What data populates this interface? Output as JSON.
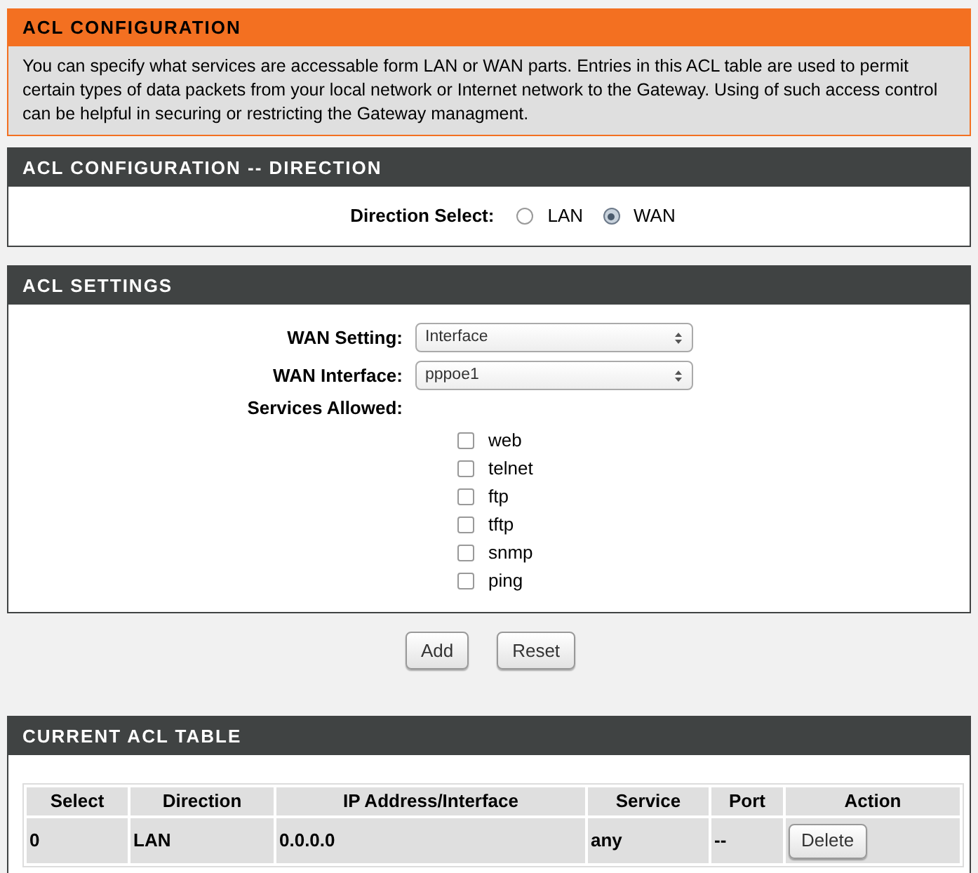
{
  "intro": {
    "title": "ACL CONFIGURATION",
    "text": "You can specify what services are accessable form LAN or WAN parts.   Entries in this ACL table are used to permit certain types of data packets from your local network or Internet network to the Gateway.   Using of such access control can be helpful in securing or restricting the Gateway managment."
  },
  "direction": {
    "title": "ACL CONFIGURATION -- DIRECTION",
    "label": "Direction Select:",
    "options": [
      {
        "label": "LAN",
        "selected": false
      },
      {
        "label": "WAN",
        "selected": true
      }
    ]
  },
  "settings": {
    "title": "ACL SETTINGS",
    "fields": [
      {
        "label": "WAN Setting:",
        "value": "Interface"
      },
      {
        "label": "WAN Interface:",
        "value": "pppoe1"
      }
    ],
    "services_label": "Services Allowed:",
    "services": [
      {
        "label": "web",
        "checked": false
      },
      {
        "label": "telnet",
        "checked": false
      },
      {
        "label": "ftp",
        "checked": false
      },
      {
        "label": "tftp",
        "checked": false
      },
      {
        "label": "snmp",
        "checked": false
      },
      {
        "label": "ping",
        "checked": false
      }
    ]
  },
  "buttons": [
    "Add",
    "Reset"
  ],
  "table": {
    "title": "CURRENT ACL TABLE",
    "columns": [
      "Select",
      "Direction",
      "IP Address/Interface",
      "Service",
      "Port",
      "Action"
    ],
    "rows": [
      {
        "cells": [
          "0",
          "LAN",
          "0.0.0.0",
          "any",
          "--"
        ],
        "action": "Delete"
      }
    ]
  }
}
